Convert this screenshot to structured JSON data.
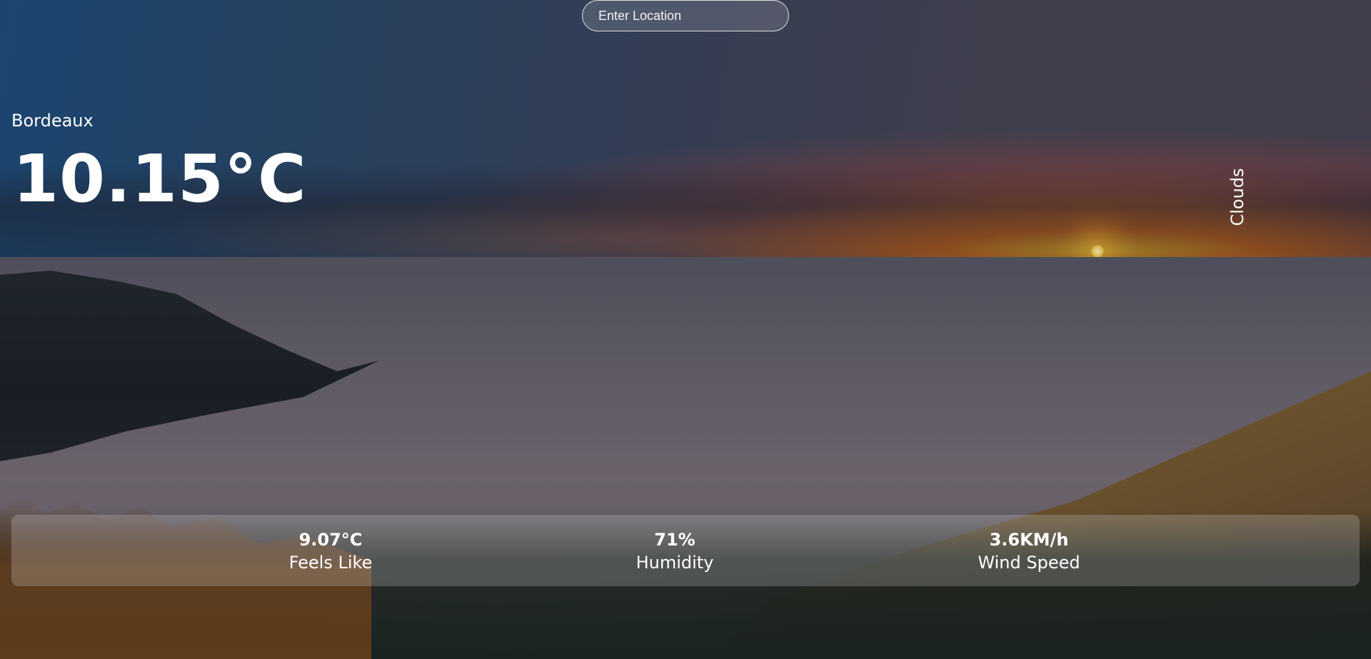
{
  "search": {
    "placeholder": "Enter Location",
    "value": ""
  },
  "weather": {
    "location": "Bordeaux",
    "temperature": "10.15°C",
    "description": "Clouds"
  },
  "stats": {
    "feels_like": {
      "value": "9.07°C",
      "label": "Feels Like"
    },
    "humidity": {
      "value": "71%",
      "label": "Humidity"
    },
    "wind_speed": {
      "value": "3.6KM/h",
      "label": "Wind Speed"
    }
  },
  "theme": {
    "text_color": "#ffffff",
    "panel_background": "rgba(255,255,255,0.2)"
  }
}
